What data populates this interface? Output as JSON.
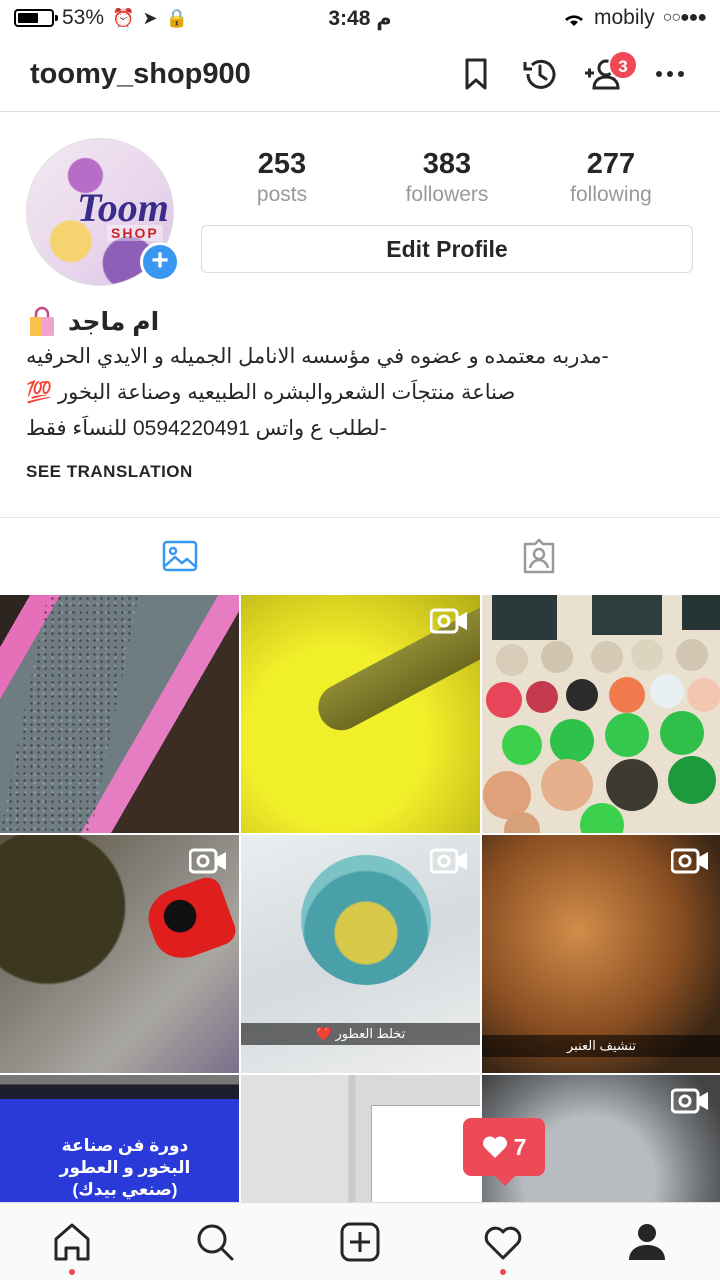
{
  "status_bar": {
    "battery": "53%",
    "time": "3:48 م",
    "carrier": "mobily",
    "signal": "○○●●●"
  },
  "header": {
    "username": "toomy_shop900",
    "notification_count": "3"
  },
  "profile": {
    "avatar_text": "Toom",
    "avatar_subtext": "SHOP",
    "stats": [
      {
        "value": "253",
        "label": "posts"
      },
      {
        "value": "383",
        "label": "followers"
      },
      {
        "value": "277",
        "label": "following"
      }
    ],
    "edit_profile_label": "Edit Profile",
    "display_name": "ام ماجد",
    "bio_lines": [
      "-مدربه معتمده و عضوه في مؤسسه الانامل الجميله و الايدي الحرفيه",
      "صناعة منتجاَت الشعروالبشره الطبيعيه وصناعة البخور 💯",
      "-لطلب ع واتس 0594220491 للنساَء فقط"
    ],
    "see_translation": "SEE TRANSLATION"
  },
  "grid": {
    "captions": {
      "post5": "تخلط العطور ❤️",
      "post6": "تنشيف العنبر",
      "post7": "دورة فن صناعة البخور و العطور (صنعي بيدك)"
    }
  },
  "like_popup": {
    "count": "7"
  },
  "colors": {
    "accent_blue": "#3897f0",
    "badge_red": "#ed4956",
    "text": "#262626",
    "muted": "#999999"
  }
}
